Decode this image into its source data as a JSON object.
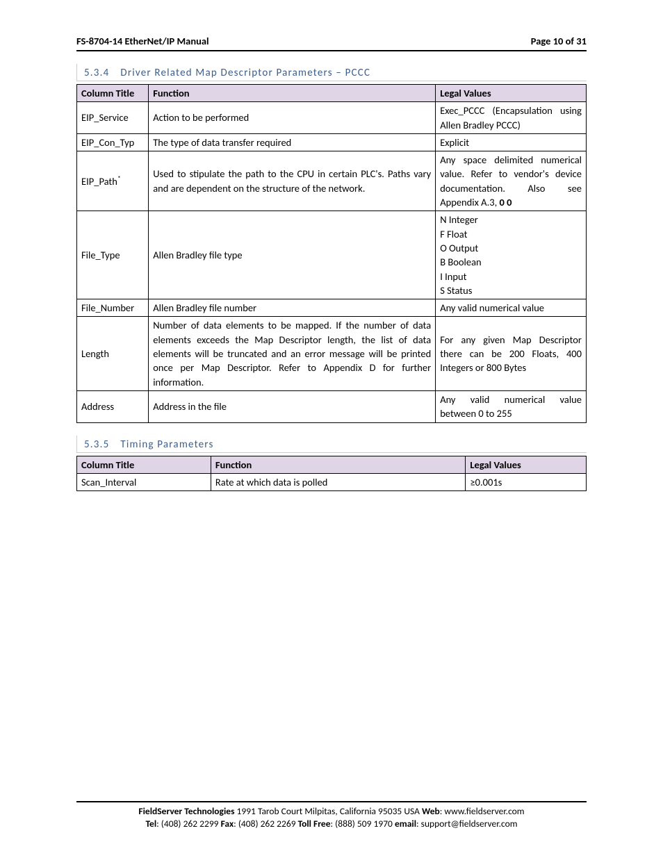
{
  "header": {
    "left": "FS-8704-14 EtherNet/IP Manual",
    "right": "Page 10 of 31"
  },
  "section534": {
    "number": "5.3.4",
    "title": "Driver Related Map Descriptor Parameters – PCCC",
    "headers": {
      "c1": "Column Title",
      "c2": "Function",
      "c3": "Legal Values"
    },
    "rows": [
      {
        "c1": "EIP_Service",
        "c2": "Action to be performed",
        "c3": "Exec_PCCC (Encapsulation using Allen Bradley PCCC)"
      },
      {
        "c1": "EIP_Con_Typ",
        "c2": "The type of data transfer required",
        "c3": "Explicit"
      },
      {
        "c1": "EIP_Path",
        "sup": "*",
        "c2": "Used to stipulate the path to the CPU in certain PLC's. Paths vary and are dependent on the structure of the network.",
        "c3_pre": "Any space delimited numerical value. Refer to vendor's device documentation. Also see Appendix A.3, ",
        "c3_bold": "0 0"
      },
      {
        "c1": "File_Type",
        "c2": "Allen Bradley file type",
        "c3_lines": [
          "N Integer",
          "F Float",
          "O Output",
          "B Boolean",
          "I Input",
          "S Status"
        ]
      },
      {
        "c1": "File_Number",
        "c2": "Allen Bradley file number",
        "c3": "Any valid numerical value"
      },
      {
        "c1": "Length",
        "c2": "Number of data elements to be mapped. If the number of data elements exceeds the Map Descriptor length, the list of data elements will be truncated and an error message will be printed once per Map Descriptor. Refer to Appendix D for further information.",
        "c3": "For any given Map Descriptor there can be 200 Floats, 400 Integers or 800 Bytes"
      },
      {
        "c1": "Address",
        "c2": "Address in the file",
        "c3": "Any valid numerical value between 0 to 255"
      }
    ]
  },
  "section535": {
    "number": "5.3.5",
    "title": "Timing Parameters",
    "headers": {
      "c1": "Column Title",
      "c2": "Function",
      "c3": "Legal Values"
    },
    "rows": [
      {
        "c1": "Scan_Interval",
        "c2": "Rate at which data is polled",
        "c3": "≥0.001s"
      }
    ]
  },
  "footer": {
    "line1_b1": "FieldServer Technologies",
    "line1_addr": " 1991 Tarob Court Milpitas, California 95035 USA   ",
    "line1_b2": "Web",
    "line1_web": ": www.fieldserver.com",
    "line2_b1": "Tel",
    "line2_tel": ": (408) 262 2299   ",
    "line2_b2": "Fax",
    "line2_fax": ": (408) 262 2269   ",
    "line2_b3": "Toll Free",
    "line2_toll": ": (888) 509 1970   ",
    "line2_b4": "email",
    "line2_email": ": support@fieldserver.com"
  }
}
